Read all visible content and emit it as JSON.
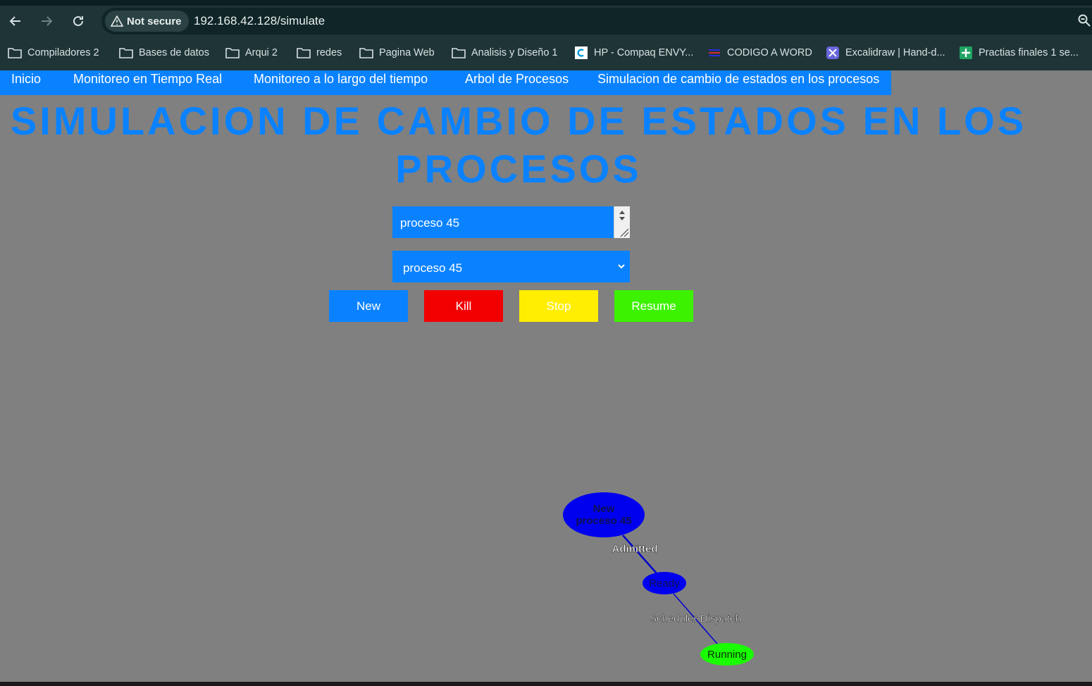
{
  "browser": {
    "security_label": "Not secure",
    "url": "192.168.42.128/simulate",
    "bookmarks": [
      {
        "label": "Compiladores 2",
        "icon": "folder-icon"
      },
      {
        "label": "Bases de datos",
        "icon": "folder-icon"
      },
      {
        "label": "Arqui 2",
        "icon": "folder-icon"
      },
      {
        "label": "redes",
        "icon": "folder-icon"
      },
      {
        "label": "Pagina Web",
        "icon": "folder-icon"
      },
      {
        "label": "Analisis y Diseño 1",
        "icon": "folder-icon"
      },
      {
        "label": "HP - Compaq ENVY...",
        "icon": "site-favicon"
      },
      {
        "label": "CODIGO A WORD",
        "icon": "site-favicon"
      },
      {
        "label": "Excalidraw | Hand-d...",
        "icon": "site-favicon"
      },
      {
        "label": "Practias finales 1 se...",
        "icon": "sheets-icon"
      }
    ]
  },
  "nav": {
    "items": [
      {
        "label": "Inicio"
      },
      {
        "label": "Monitoreo en Tiempo Real"
      },
      {
        "label": "Monitoreo a lo largo del tiempo"
      },
      {
        "label": "Arbol de Procesos"
      },
      {
        "label": "Simulacion de cambio de estados en los procesos"
      }
    ]
  },
  "page": {
    "title": "SIMULACION DE CAMBIO DE ESTADOS EN LOS PROCESOS"
  },
  "form": {
    "name_value": "proceso 45",
    "selected_process": "proceso 45",
    "buttons": {
      "new": "New",
      "kill": "Kill",
      "stop": "Stop",
      "resume": "Resume"
    }
  },
  "colors": {
    "page_bg": "#808080",
    "accent": "#0a82ff",
    "kill": "#f20000",
    "stop": "#ffee00",
    "resume": "#3df200",
    "node_blue": "#0000ee",
    "node_running": "#1aff00"
  },
  "graph": {
    "nodes": [
      {
        "id": "new",
        "lines": [
          "New",
          "proceso 45"
        ]
      },
      {
        "id": "ready",
        "label": "Ready"
      },
      {
        "id": "running",
        "label": "Running"
      }
    ],
    "edges": [
      {
        "from": "new",
        "to": "ready",
        "label": "Admitted"
      },
      {
        "from": "ready",
        "to": "running",
        "label": "Scheduler Dispatch"
      }
    ]
  }
}
